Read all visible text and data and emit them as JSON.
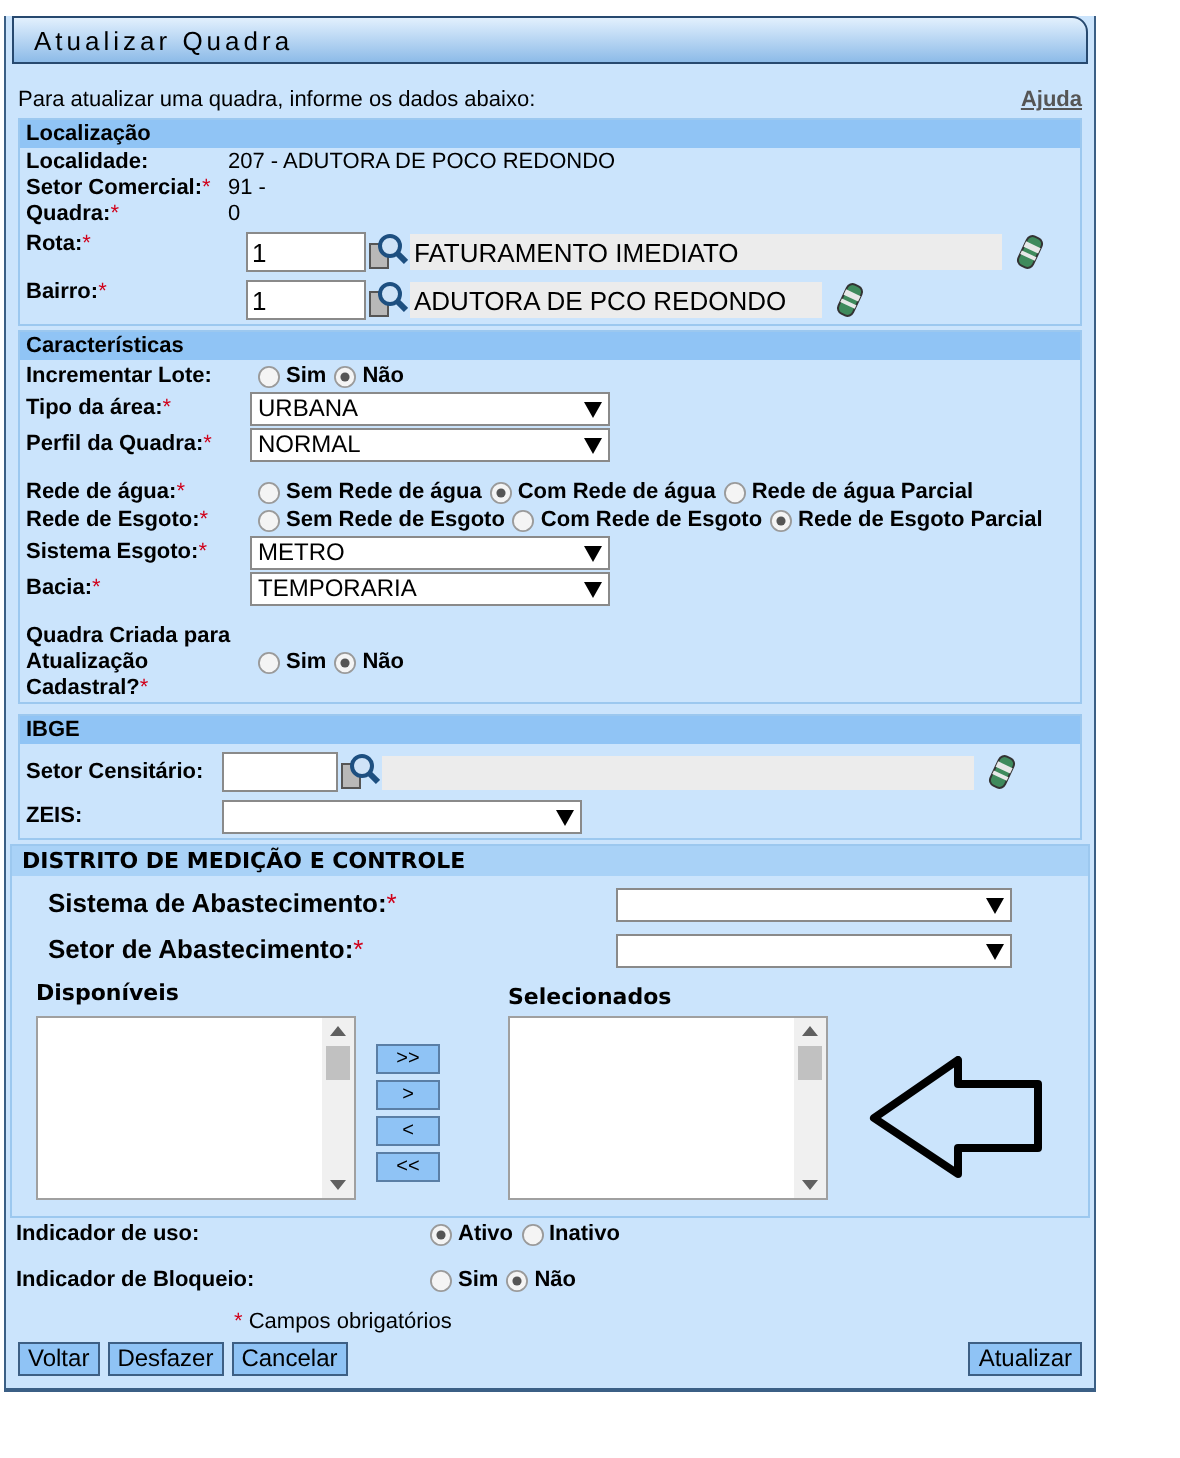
{
  "window": {
    "title": "Atualizar Quadra"
  },
  "intro": "Para atualizar uma quadra, informe os dados abaixo:",
  "help_link": "Ajuda",
  "localizacao": {
    "title": "Localização",
    "info": [
      {
        "label": "Localidade:",
        "value": "207 - ADUTORA DE POCO REDONDO"
      },
      {
        "label": "Setor Comercial:",
        "mark": "*",
        "value": "91 -"
      },
      {
        "label": "Quadra:",
        "mark": "*",
        "value": "0"
      }
    ],
    "lookups": [
      {
        "label": "Rota:",
        "mark": "*",
        "code": "1",
        "description": "FATURAMENTO IMEDIATO"
      },
      {
        "label": "Bairro:",
        "mark": "*",
        "code": "1",
        "description": "ADUTORA DE PCO REDONDO"
      }
    ]
  },
  "caracteristicas": {
    "title": "Características",
    "rows": [
      {
        "kind": "radio",
        "label": "Incrementar Lote:",
        "options": [
          {
            "label": "Sim",
            "selected": false
          },
          {
            "label": "Não",
            "selected": true
          }
        ]
      },
      {
        "kind": "select",
        "label": "Tipo da área:",
        "mark": "*",
        "value": "URBANA"
      },
      {
        "kind": "select",
        "label": "Perfil da Quadra:",
        "mark": "*",
        "value": "NORMAL"
      },
      {
        "kind": "radio",
        "label": "Rede de água:",
        "mark": "*",
        "options": [
          {
            "label": "Sem Rede de água",
            "selected": false
          },
          {
            "label": "Com Rede de água",
            "selected": true
          },
          {
            "label": "Rede de água Parcial",
            "selected": false
          }
        ]
      },
      {
        "kind": "radio",
        "label": "Rede de Esgoto:",
        "mark": "*",
        "options": [
          {
            "label": "Sem Rede de Esgoto",
            "selected": false
          },
          {
            "label": "Com Rede de Esgoto",
            "selected": false
          },
          {
            "label": "Rede de Esgoto Parcial",
            "selected": true
          }
        ]
      },
      {
        "kind": "select",
        "label": "Sistema Esgoto:",
        "mark": "*",
        "value": "METRO"
      },
      {
        "kind": "select",
        "label": "Bacia:",
        "mark": "*",
        "value": "TEMPORARIA"
      },
      {
        "kind": "radio",
        "label": "Quadra Criada para Atualização Cadastral?",
        "mark": "*",
        "options": [
          {
            "label": "Sim",
            "selected": false
          },
          {
            "label": "Não",
            "selected": true
          }
        ]
      }
    ]
  },
  "ibge": {
    "title": "IBGE",
    "lookup": {
      "label": "Setor Censitário:"
    },
    "zeis": {
      "label": "ZEIS:"
    }
  },
  "dmc": {
    "title": "DISTRITO DE MEDIÇÃO E CONTROLE",
    "selects": [
      {
        "label": "Sistema de Abastecimento:",
        "mark": "*"
      },
      {
        "label": "Setor de Abastecimento:",
        "mark": "*"
      }
    ],
    "available_label": "Disponíveis",
    "selected_label": "Selecionados",
    "transfer_buttons": [
      ">>",
      ">",
      "<",
      "<<"
    ]
  },
  "indicators": [
    {
      "label": "Indicador de uso:",
      "options": [
        {
          "label": "Ativo",
          "selected": true
        },
        {
          "label": "Inativo",
          "selected": false
        }
      ]
    },
    {
      "label": "Indicador de Bloqueio:",
      "options": [
        {
          "label": "Sim",
          "selected": false
        },
        {
          "label": "Não",
          "selected": true
        }
      ]
    }
  ],
  "required_note": {
    "mark": "*",
    "text": "Campos obrigatórios"
  },
  "buttons_left": [
    "Voltar",
    "Desfazer",
    "Cancelar"
  ],
  "buttons_right": [
    "Atualizar"
  ]
}
